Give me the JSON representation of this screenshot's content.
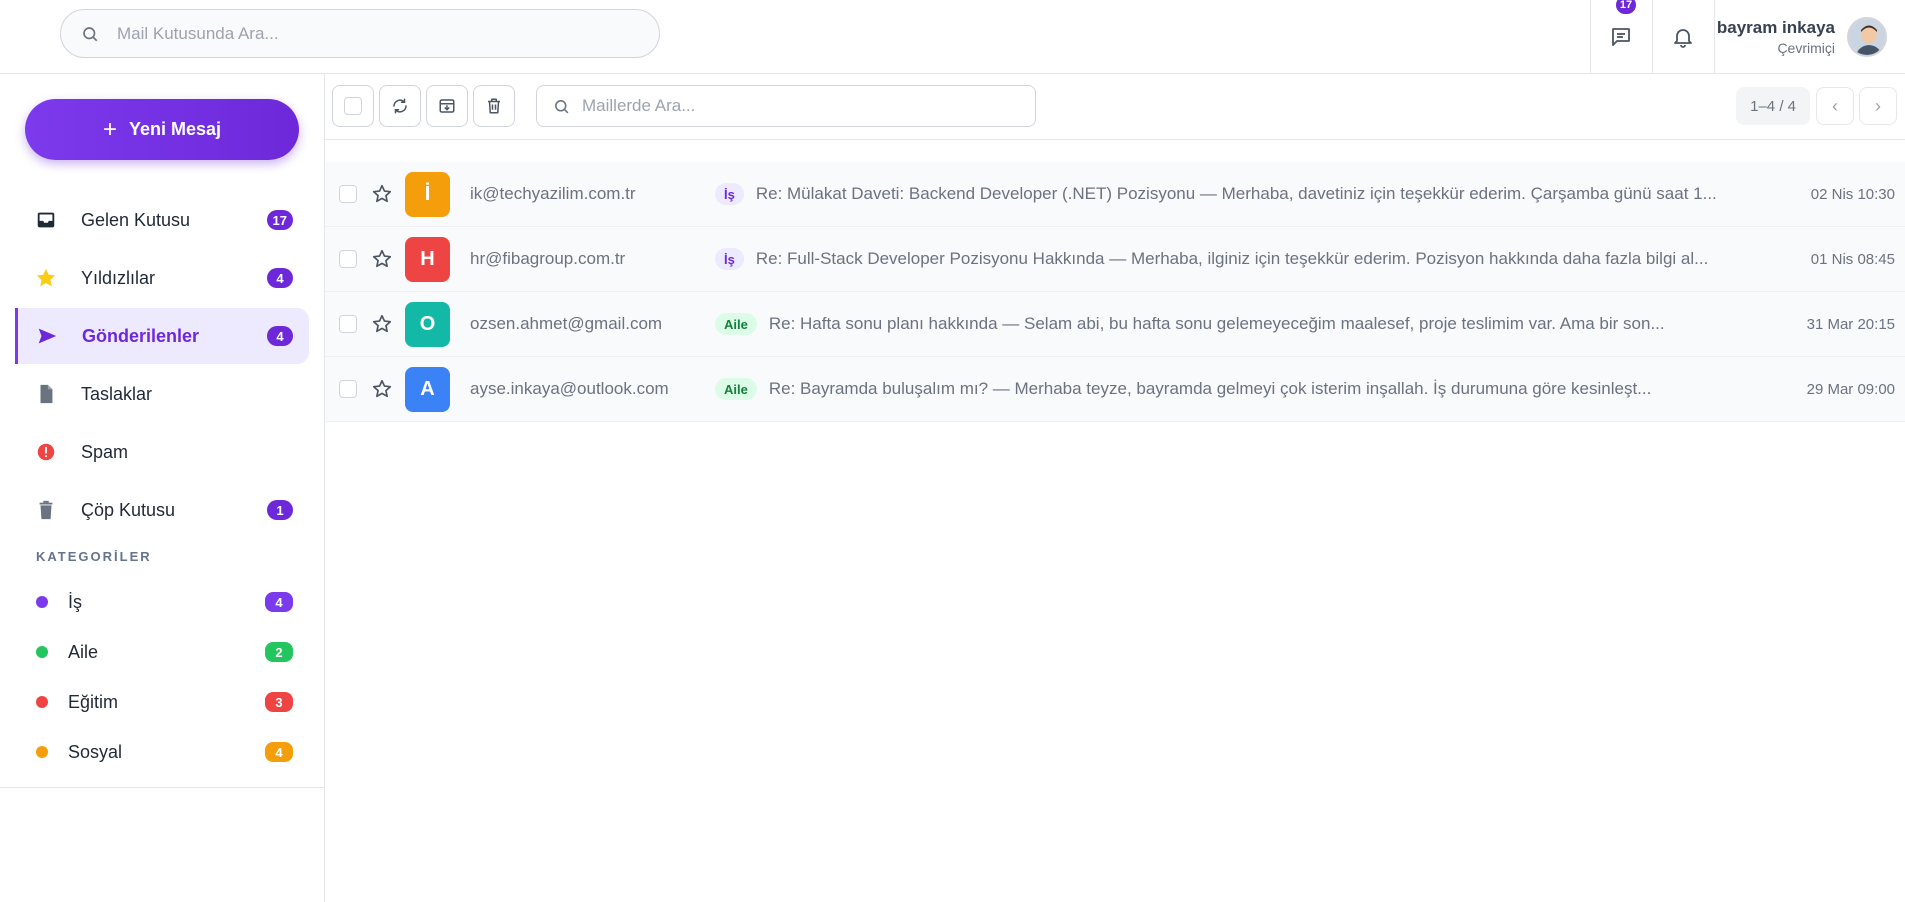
{
  "header": {
    "search_placeholder": "Mail Kutusunda Ara...",
    "message_badge": "17",
    "user_name": "bayram inkaya",
    "user_status": "Çevrimiçi"
  },
  "sidebar": {
    "compose_label": "Yeni Mesaj",
    "items": [
      {
        "label": "Gelen Kutusu",
        "count": "17",
        "icon": "inbox-icon"
      },
      {
        "label": "Yıldızlılar",
        "count": "4",
        "icon": "star-icon"
      },
      {
        "label": "Gönderilenler",
        "count": "4",
        "icon": "send-icon"
      },
      {
        "label": "Taslaklar",
        "count": "",
        "icon": "draft-file-icon"
      },
      {
        "label": "Spam",
        "count": "",
        "icon": "spam-alert-icon"
      },
      {
        "label": "Çöp Kutusu",
        "count": "1",
        "icon": "trash-icon"
      }
    ],
    "categories_heading": "KATEGORİLER",
    "categories": [
      {
        "label": "İş",
        "count": "4",
        "color": "#7c3aed"
      },
      {
        "label": "Aile",
        "count": "2",
        "color": "#22c55e"
      },
      {
        "label": "Eğitim",
        "count": "3",
        "color": "#ef4444"
      },
      {
        "label": "Sosyal",
        "count": "4",
        "color": "#f59e0b"
      }
    ]
  },
  "toolbar": {
    "search_placeholder": "Maillerde Ara...",
    "pagination": "1–4 / 4"
  },
  "mails": [
    {
      "initial": "İ",
      "avatar_color": "#f59e0b",
      "sender": "ik@techyazilim.com.tr",
      "tag": "İş",
      "tag_type": "is",
      "subject": "Re: Mülakat Daveti: Backend Developer (.NET) Pozisyonu — Merhaba, davetiniz için teşekkür ederim. Çarşamba günü saat 1...",
      "date": "02 Nis 10:30"
    },
    {
      "initial": "H",
      "avatar_color": "#ef4444",
      "sender": "hr@fibagroup.com.tr",
      "tag": "İş",
      "tag_type": "is",
      "subject": "Re: Full-Stack Developer Pozisyonu Hakkında — Merhaba, ilginiz için teşekkür ederim. Pozisyon hakkında daha fazla bilgi al...",
      "date": "01 Nis 08:45"
    },
    {
      "initial": "O",
      "avatar_color": "#14b8a6",
      "sender": "ozsen.ahmet@gmail.com",
      "tag": "Aile",
      "tag_type": "aile",
      "subject": "Re: Hafta sonu planı hakkında — Selam abi, bu hafta sonu gelemeyeceğim maalesef, proje teslimim var. Ama bir son...",
      "date": "31 Mar 20:15"
    },
    {
      "initial": "A",
      "avatar_color": "#3b82f6",
      "sender": "ayse.inkaya@outlook.com",
      "tag": "Aile",
      "tag_type": "aile",
      "subject": "Re: Bayramda buluşalım mı? — Merhaba teyze, bayramda gelmeyi çok isterim inşallah. İş durumuna göre kesinleşt...",
      "date": "29 Mar 09:00"
    }
  ]
}
